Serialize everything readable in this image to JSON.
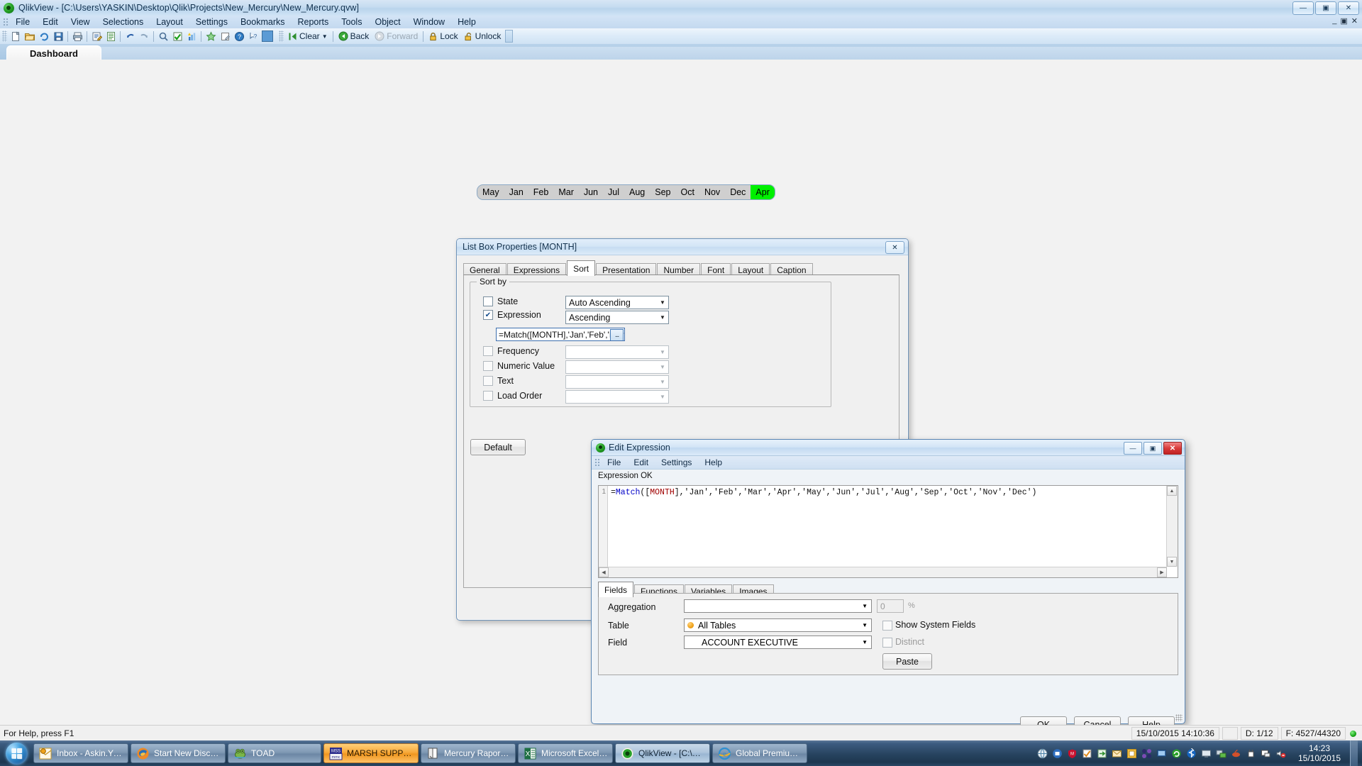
{
  "window": {
    "title": "QlikView - [C:\\Users\\YASKIN\\Desktop\\Qlik\\Projects\\New_Mercury\\New_Mercury.qvw]",
    "minimize": "—",
    "maximize": "▣",
    "close": "✕"
  },
  "menubar": {
    "items": [
      "File",
      "Edit",
      "View",
      "Selections",
      "Layout",
      "Settings",
      "Bookmarks",
      "Reports",
      "Tools",
      "Object",
      "Window",
      "Help"
    ],
    "doc_minimize": "_",
    "doc_restore": "▣",
    "doc_close": "✕"
  },
  "toolbar": {
    "clear_label": "Clear",
    "back_label": "Back",
    "forward_label": "Forward",
    "lock_label": "Lock",
    "unlock_label": "Unlock"
  },
  "sheet_tabs": {
    "active": "Dashboard"
  },
  "month_listbox": {
    "values": [
      "May",
      "Jan",
      "Feb",
      "Mar",
      "Jun",
      "Jul",
      "Aug",
      "Sep",
      "Oct",
      "Nov",
      "Dec",
      "Apr"
    ],
    "selected": "Apr",
    "selected_color": "#00f000"
  },
  "listbox_properties": {
    "title": "List Box Properties [MONTH]",
    "close_glyph": "✕",
    "tabs": [
      "General",
      "Expressions",
      "Sort",
      "Presentation",
      "Number",
      "Font",
      "Layout",
      "Caption"
    ],
    "active_tab": "Sort",
    "group_legend": "Sort by",
    "rows": [
      {
        "label": "State",
        "checked": false,
        "value": "Auto Ascending",
        "enabled": true
      },
      {
        "label": "Expression",
        "checked": true,
        "value": "Ascending",
        "enabled": true
      },
      {
        "label": "Frequency",
        "checked": false,
        "value": "",
        "enabled": false
      },
      {
        "label": "Numeric Value",
        "checked": false,
        "value": "",
        "enabled": false
      },
      {
        "label": "Text",
        "checked": false,
        "value": "",
        "enabled": false
      },
      {
        "label": "Load Order",
        "checked": false,
        "value": "",
        "enabled": false
      }
    ],
    "expression_value": "=Match([MONTH],'Jan','Feb','Mar','Apr",
    "expression_button": "...",
    "default_button": "Default",
    "check_glyph": "✔"
  },
  "edit_expression": {
    "title": "Edit Expression",
    "minimize": "—",
    "restore": "▣",
    "close": "✕",
    "menu": [
      "File",
      "Edit",
      "Settings",
      "Help"
    ],
    "status": "Expression OK",
    "line_number": "1",
    "code": {
      "prefix": "=",
      "func": "Match",
      "open": "([",
      "field": "MONTH",
      "rest": "],'Jan','Feb','Mar','Apr','May','Jun','Jul','Aug','Sep','Oct','Nov','Dec')"
    },
    "code_plain": "=Match([MONTH],'Jan','Feb','Mar','Apr','May','Jun','Jul','Aug','Sep','Oct','Nov','Dec')",
    "tabs": [
      "Fields",
      "Functions",
      "Variables",
      "Images"
    ],
    "active_tab": "Fields",
    "fields": {
      "aggregation_label": "Aggregation",
      "aggregation_value": "",
      "percent_value": "0",
      "percent_symbol": "%",
      "table_label": "Table",
      "table_value": "All Tables",
      "field_label": "Field",
      "field_value": "ACCOUNT EXECUTIVE",
      "show_system_fields": "Show System Fields",
      "distinct": "Distinct",
      "paste_button": "Paste"
    },
    "buttons": {
      "ok": "OK",
      "cancel": "Cancel",
      "help": "Help"
    }
  },
  "statusbar": {
    "help_text": "For Help, press F1",
    "datetime": "15/10/2015 14:10:36",
    "selections": "D: 1/12",
    "rows": "F: 4527/44320"
  },
  "taskbar": {
    "tasks": [
      {
        "label": "Inbox - Askin.Yildi...",
        "icon": "outlook-icon",
        "state": "normal"
      },
      {
        "label": "Start New Discuss...",
        "icon": "firefox-icon",
        "state": "normal"
      },
      {
        "label": "TOAD",
        "icon": "toad-icon",
        "state": "normal"
      },
      {
        "label": "MARSH SUPPORT...",
        "icon": "mmc-icon",
        "state": "orange"
      },
      {
        "label": "Mercury Raporu [...",
        "icon": "document-icon",
        "state": "normal"
      },
      {
        "label": "Microsoft Excel - ...",
        "icon": "excel-icon",
        "state": "normal"
      },
      {
        "label": "QlikView - [C:\\Us...",
        "icon": "qlikview-icon",
        "state": "active"
      },
      {
        "label": "Global Premium ...",
        "icon": "ie-icon",
        "state": "normal"
      }
    ],
    "clock_time": "14:23",
    "clock_date": "15/10/2015"
  }
}
